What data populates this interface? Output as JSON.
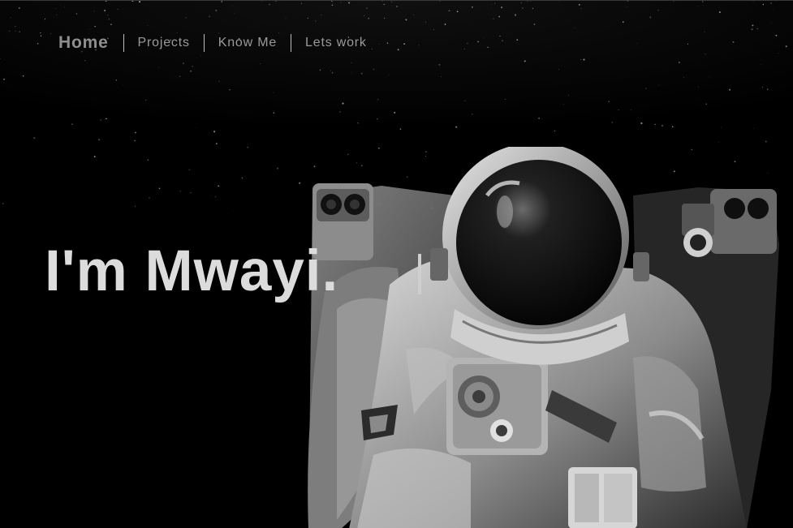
{
  "nav": {
    "items": [
      {
        "label": "Home"
      },
      {
        "label": "Projects"
      },
      {
        "label": "Know Me"
      },
      {
        "label": "Lets work"
      }
    ]
  },
  "hero": {
    "headline": "I'm Mwayi.",
    "image_subject": "astronaut-photo"
  },
  "colors": {
    "background": "#000000",
    "nav_text": "#9a9a9a",
    "headline": "#dcdcdc"
  }
}
